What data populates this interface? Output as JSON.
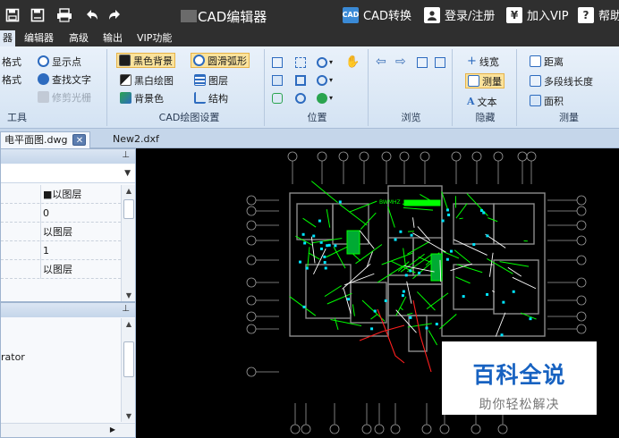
{
  "titlebar": {
    "app_title": "CAD编辑器",
    "cad_convert": "CAD转换",
    "login": "登录/注册",
    "vip": "加入VIP",
    "help": "帮助",
    "vip_symbol": "¥",
    "help_symbol": "?"
  },
  "menu": {
    "tabs": [
      "器",
      "编辑器",
      "高级",
      "输出",
      "VIP功能"
    ],
    "active": "器"
  },
  "ribbon": {
    "tools": {
      "label": "工具",
      "items": [
        "格式",
        "格式",
        "显示点",
        "查找文字",
        "修剪光栅"
      ]
    },
    "cad_settings": {
      "label": "CAD绘图设置",
      "items": [
        "黑色背景",
        "圆滑弧形",
        "黑白绘图",
        "图层",
        "背景色",
        "结构"
      ]
    },
    "position": {
      "label": "位置"
    },
    "browse": {
      "label": "浏览"
    },
    "hide": {
      "label": "隐藏",
      "items": [
        "线宽",
        "测量",
        "文本"
      ]
    },
    "measure": {
      "label": "测量",
      "items": [
        "距离",
        "多段线长度",
        "面积"
      ]
    }
  },
  "documents": {
    "tabs": [
      "电平面图.dwg",
      "New2.dxf"
    ],
    "close_symbol": "✕"
  },
  "properties": {
    "values": [
      "■以图层",
      "0",
      "以图层",
      "1",
      "以图层"
    ]
  },
  "layers_panel": {
    "text": "rator"
  },
  "canvas": {
    "colors": {
      "background": "#000000",
      "walls": "#8c8c8c",
      "wiring": "#00ff00",
      "red": "#ff1f1f",
      "cyan": "#00e5ff",
      "white": "#ffffff"
    },
    "label": "BWMHZ"
  },
  "watermark": {
    "main": "百科全说",
    "sub": "助你轻松解决"
  }
}
